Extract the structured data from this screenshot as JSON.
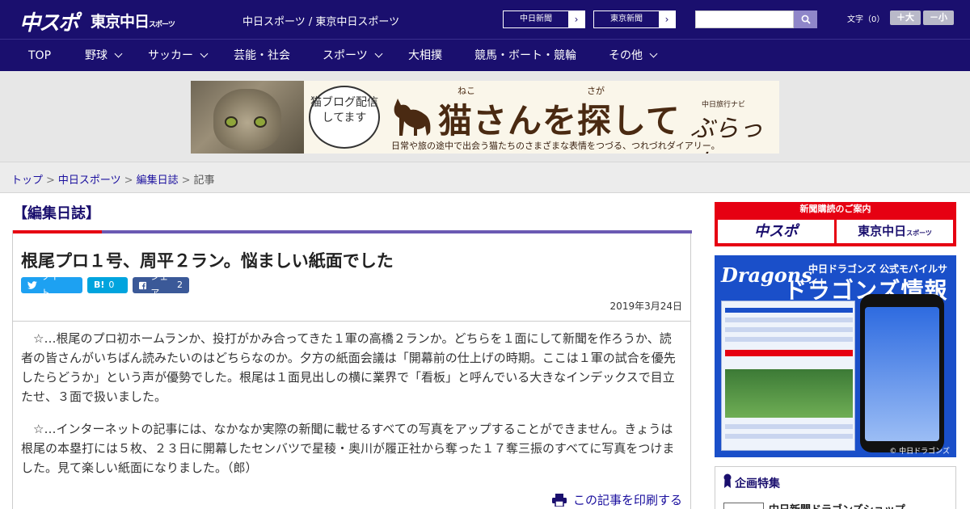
{
  "header": {
    "logo_main": "中スポ",
    "logo_tokyo": "東京中日",
    "logo_tokyo_small": "スポーツ",
    "site_name": "中日スポーツ / 東京中日スポーツ",
    "paper_buttons": [
      "中日新聞",
      "東京新聞"
    ],
    "text_size_label": "文字（0）",
    "text_size_up": "＋大",
    "text_size_down": "－小"
  },
  "nav": {
    "items": [
      {
        "label": "TOP",
        "dropdown": false
      },
      {
        "label": "野球",
        "dropdown": true
      },
      {
        "label": "サッカー",
        "dropdown": true
      },
      {
        "label": "芸能・社会",
        "dropdown": false
      },
      {
        "label": "スポーツ",
        "dropdown": true
      },
      {
        "label": "大相撲",
        "dropdown": false
      },
      {
        "label": "競馬・ボート・競輪",
        "dropdown": false
      },
      {
        "label": "その他",
        "dropdown": true
      }
    ]
  },
  "banner": {
    "bubble_text": "猫ブログ配信してます",
    "title": "猫さんを探して",
    "ruby_neko": "ねこ",
    "ruby_saga": "さが",
    "subtitle": "日常や旅の途中で出会う猫たちのさまざまな表情をつづる、つれづれダイアリー。",
    "brand_small": "中日旅行ナビ",
    "brand": "ぶらっ人"
  },
  "breadcrumb": {
    "items": [
      "トップ",
      "中日スポーツ",
      "編集日誌"
    ],
    "current": "記事",
    "separator": ">"
  },
  "article": {
    "section": "【編集日誌】",
    "headline": "根尾プロ１号、周平２ラン。悩ましい紙面でした",
    "share": {
      "twitter": "ツイート",
      "hatena_label": "B!",
      "hatena_count": "0",
      "facebook": "シェア",
      "facebook_count": "2"
    },
    "date": "2019年3月24日",
    "paragraphs": [
      "☆…根尾のプロ初ホームランか、投打がかみ合ってきた１軍の高橋２ランか。どちらを１面にして新聞を作ろうか、読者の皆さんがいちばん読みたいのはどちらなのか。夕方の紙面会議は「開幕前の仕上げの時期。ここは１軍の試合を優先したらどうか」という声が優勢でした。根尾は１面見出しの横に業界で「看板」と呼んでいる大きなインデックスで目立たせ、３面で扱いました。",
      "☆…インターネットの記事には、なかなか実際の新聞に載せるすべての写真をアップすることができません。きょうは根尾の本塁打には５枚、２３日に開幕したセンバツで星稜・奥川が履正社から奪った１７奪三振のすべてに写真をつけました。見て楽しい紙面になりました。（郎）"
    ],
    "print_label": "この記事を印刷する"
  },
  "sidebar": {
    "subscribe_header": "新聞購読のご案内",
    "subscribe_left": "中スポ",
    "subscribe_right": "東京中日",
    "subscribe_right_small": "スポーツ",
    "dragons_logo": "Dragons",
    "dragons_sub": "中日ドラゴンズ 公式モバイルサイト",
    "dragons_title": "ドラゴンズ情報",
    "dragons_copyright": "© 中日ドラゴンズ",
    "feature_title": "企画特集",
    "feature_item": "中日新聞ドラゴンズショップ"
  },
  "colors": {
    "header_bg": "#1a0f6e",
    "accent_red": "#e60012",
    "accent_purple": "#6b5ab3",
    "link": "#1a0f9e",
    "twitter": "#1da1f2",
    "hatena": "#00a4de",
    "facebook": "#3b5998"
  }
}
